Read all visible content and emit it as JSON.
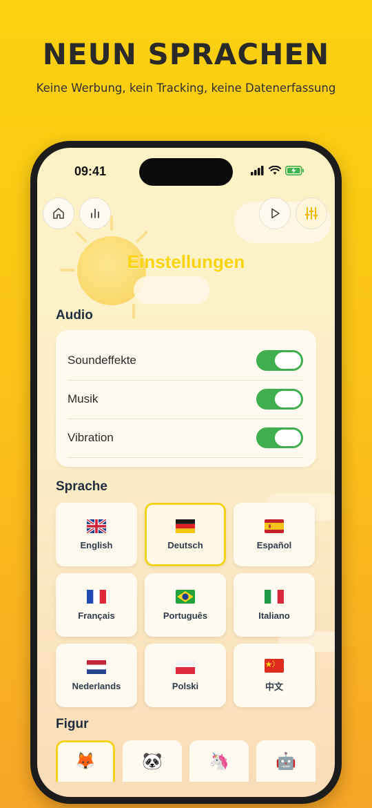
{
  "promo": {
    "title": "NEUN SPRACHEN",
    "subtitle": "Keine Werbung, kein Tracking, keine Datenerfassung"
  },
  "status_bar": {
    "time": "09:41"
  },
  "nav": {
    "left": [
      {
        "icon": "home-icon"
      },
      {
        "icon": "stats-icon"
      }
    ],
    "right": [
      {
        "icon": "play-icon"
      },
      {
        "icon": "sliders-icon"
      }
    ]
  },
  "page": {
    "title": "Einstellungen"
  },
  "audio": {
    "label": "Audio",
    "rows": [
      {
        "label": "Soundeffekte",
        "on": true
      },
      {
        "label": "Musik",
        "on": true
      },
      {
        "label": "Vibration",
        "on": true
      }
    ]
  },
  "language": {
    "label": "Sprache",
    "selected": "Deutsch",
    "options": [
      {
        "name": "English",
        "flag": "gb"
      },
      {
        "name": "Deutsch",
        "flag": "de"
      },
      {
        "name": "Español",
        "flag": "es"
      },
      {
        "name": "Français",
        "flag": "fr"
      },
      {
        "name": "Português",
        "flag": "br"
      },
      {
        "name": "Italiano",
        "flag": "it"
      },
      {
        "name": "Nederlands",
        "flag": "nl"
      },
      {
        "name": "Polski",
        "flag": "pl"
      },
      {
        "name": "中文",
        "flag": "cn"
      }
    ]
  },
  "figure": {
    "label": "Figur",
    "options": [
      {
        "emoji": "🦊",
        "icon": "fox-icon",
        "selected": true
      },
      {
        "emoji": "🐼",
        "icon": "panda-icon",
        "selected": false
      },
      {
        "emoji": "🦄",
        "icon": "unicorn-icon",
        "selected": false
      },
      {
        "emoji": "🤖",
        "icon": "robot-icon",
        "selected": false
      }
    ]
  },
  "colors": {
    "accent": "#f3d21b",
    "toggle_on": "#3fae4e",
    "title": "#f9d40f"
  }
}
